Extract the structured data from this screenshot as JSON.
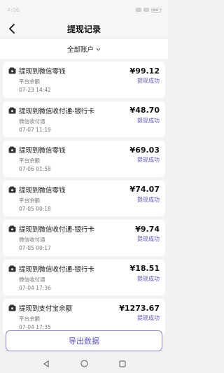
{
  "status_bar": {
    "time": "4:06"
  },
  "header": {
    "title": "提现记录"
  },
  "filter": {
    "label": "全部账户"
  },
  "records": [
    {
      "title": "提现到微信零钱",
      "source": "平台余额",
      "time": "07-23 14:42",
      "amount": "¥99.12",
      "status": "提现成功"
    },
    {
      "title": "提现到微信收付通-银行卡",
      "source": "微信收付通",
      "time": "07-07 11:19",
      "amount": "¥48.70",
      "status": "提现成功"
    },
    {
      "title": "提现到微信零钱",
      "source": "平台余额",
      "time": "07-06 01:58",
      "amount": "¥69.03",
      "status": "提现成功"
    },
    {
      "title": "提现到微信零钱",
      "source": "平台余额",
      "time": "07-05 00:18",
      "amount": "¥74.07",
      "status": "提现成功"
    },
    {
      "title": "提现到微信收付通-银行卡",
      "source": "微信收付通",
      "time": "07-05 00:17",
      "amount": "¥9.74",
      "status": "提现成功"
    },
    {
      "title": "提现到微信收付通-银行卡",
      "source": "微信收付通",
      "time": "07-04 17:36",
      "amount": "¥18.51",
      "status": "提现成功"
    },
    {
      "title": "提现到支付宝余额",
      "source": "平台余额",
      "time": "07-04 17:35",
      "amount": "¥1273.67",
      "status": "提现成功"
    }
  ],
  "footer": {
    "export_label": "导出数据"
  },
  "icons": {
    "back": "back-arrow-icon",
    "chevron": "chevron-down-icon",
    "wallet": "wallet-icon"
  },
  "colors": {
    "accent": "#5a55c8"
  }
}
